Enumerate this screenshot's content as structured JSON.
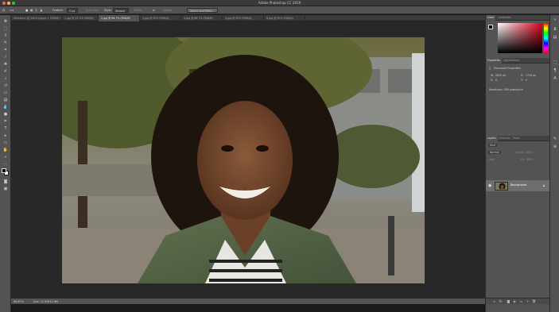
{
  "app": {
    "title": "Adobe Photoshop CC 2019"
  },
  "options_bar": {
    "feather_label": "Feather:",
    "feather_value": "0 px",
    "anti_alias_label": "Anti-alias",
    "style_label": "Style:",
    "style_value": "Normal",
    "width_label": "Width:",
    "height_label": "Height:",
    "select_mask_button": "Select and Mask..."
  },
  "tabs": [
    {
      "label": "Untitled-1 @ 100% (Layer 1, RGB/8) *",
      "active": false
    },
    {
      "label": "1.jpg @ 33.3% (RGB/8)",
      "active": false
    },
    {
      "label": "2.jpg @ 66.7% (RGB/8)",
      "active": true
    },
    {
      "label": "3.jpg @ 50% (RGB/8)",
      "active": false
    },
    {
      "label": "4.jpg @ 66.7% (RGB/8)",
      "active": false
    },
    {
      "label": "5.jpg @ 50% (RGB/8)",
      "active": false
    },
    {
      "label": "6.jpg @ 50% (RGB/8)",
      "active": false
    }
  ],
  "status_bar": {
    "zoom": "66.67%",
    "doc": "Doc: 12.9M/12.9M"
  },
  "color_panel": {
    "tabs": [
      "Color",
      "Swatches"
    ]
  },
  "properties_panel": {
    "tabs": [
      "Properties",
      "Adjustments"
    ],
    "section_title": "Document Properties",
    "w_label": "W:",
    "w_value": "2810 px",
    "h_label": "H:",
    "h_value": "1724 px",
    "x_label": "X:",
    "x_value": "0",
    "y_label": "Y:",
    "y_value": "0",
    "resolution": "Resolution: 300 pixels/inch"
  },
  "layers_panel": {
    "tabs": [
      "Layers",
      "Channels",
      "Paths"
    ],
    "kind_label": "Kind",
    "mode_label": "Normal",
    "opacity_label": "Opacity: 100%",
    "lock_label": "Lock:",
    "fill_label": "Fill: 100%",
    "layer_name": "Background"
  },
  "colors": {
    "accent": "#4a90d9",
    "traffic_close": "#ff5f57",
    "traffic_min": "#febc2e",
    "traffic_max": "#28c840"
  },
  "tools": [
    "move-tool",
    "marquee-tool",
    "lasso-tool",
    "quick-select-tool",
    "crop-tool",
    "eyedropper-tool",
    "healing-tool",
    "brush-tool",
    "stamp-tool",
    "history-brush-tool",
    "eraser-tool",
    "gradient-tool",
    "blur-tool",
    "dodge-tool",
    "pen-tool",
    "type-tool",
    "path-select-tool",
    "rectangle-tool",
    "hand-tool",
    "zoom-tool",
    "more-tools"
  ]
}
